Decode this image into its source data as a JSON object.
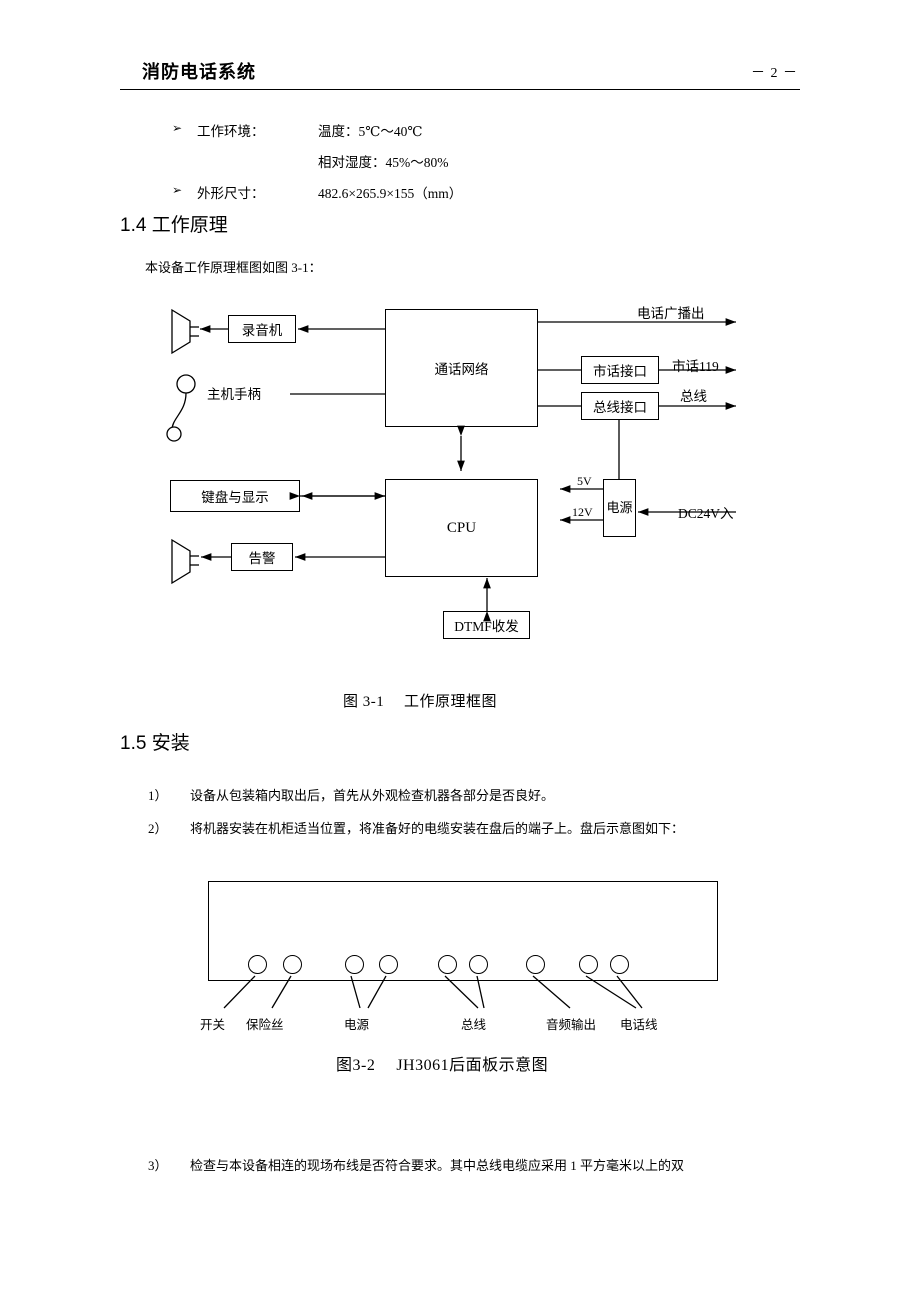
{
  "header": {
    "title": "消防电话系统",
    "page_number": "－ 2 －"
  },
  "specs": [
    {
      "bullet": "➢",
      "label": "工作环境：",
      "values": [
        "温度：5℃～40℃",
        "相对湿度：45%～80%"
      ]
    },
    {
      "bullet": "➢",
      "label": "外形尺寸：",
      "values": [
        "482.6×265.9×155（mm）"
      ]
    }
  ],
  "sections": [
    {
      "number": "1.4",
      "title": "工作原理"
    },
    {
      "number": "1.5",
      "title": "安装"
    }
  ],
  "intro_text": "本设备工作原理框图如图 3-1：",
  "diagram1": {
    "boxes": [
      {
        "id": "recorder",
        "label": "录音机"
      },
      {
        "id": "talk-network",
        "label": "通话网络"
      },
      {
        "id": "city-phone-interface",
        "label": "市话接口"
      },
      {
        "id": "bus-interface",
        "label": "总线接口"
      },
      {
        "id": "keyboard-display",
        "label": "键盘与显示"
      },
      {
        "id": "cpu",
        "label": "CPU"
      },
      {
        "id": "alarm",
        "label": "告警"
      },
      {
        "id": "power",
        "label": "电源"
      },
      {
        "id": "dtmf",
        "label": "DTMF收发"
      }
    ],
    "labels": [
      {
        "id": "host-handset",
        "text": "主机手柄"
      },
      {
        "id": "phone-broadcast-out",
        "text": "电话广播出"
      },
      {
        "id": "city-phone-119",
        "text": "市话119"
      },
      {
        "id": "bus",
        "text": "总线"
      },
      {
        "id": "dc24v-in",
        "text": "DC24V入"
      },
      {
        "id": "volt-5v",
        "text": "5V"
      },
      {
        "id": "volt-12v",
        "text": "12V"
      }
    ],
    "caption": "图 3-1　 工作原理框图"
  },
  "install_items": [
    {
      "num": "1）",
      "text": "设备从包装箱内取出后，首先从外观检查机器各部分是否良好。"
    },
    {
      "num": "2）",
      "text": "将机器安装在机柜适当位置，将准备好的电缆安装在盘后的端子上。盘后示意图如下："
    },
    {
      "num": "3）",
      "text": "检查与本设备相连的现场布线是否符合要求。其中总线电缆应采用 1 平方毫米以上的双"
    }
  ],
  "diagram2": {
    "port_labels": [
      "开关",
      "保险丝",
      "电源",
      "总线",
      "音频输出",
      "电话线"
    ],
    "caption": "图3-2　 JH3061后面板示意图"
  }
}
